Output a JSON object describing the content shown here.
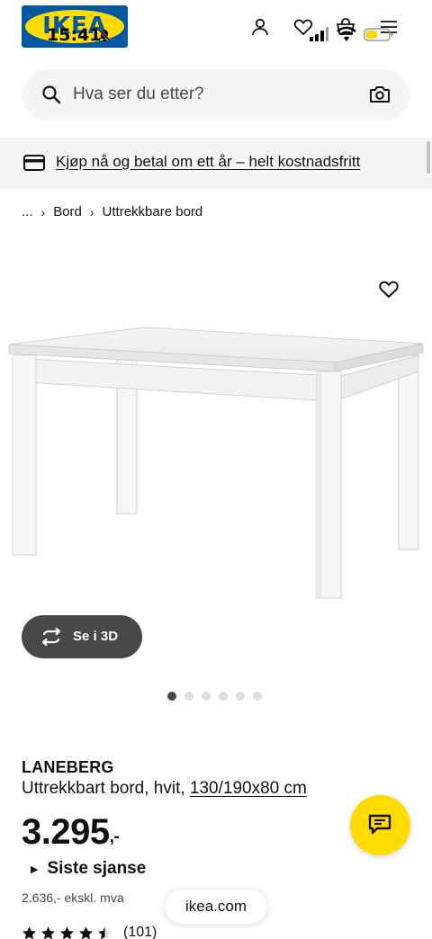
{
  "status_bar": {
    "time": "15:41"
  },
  "header": {
    "logo_text": "IKEA",
    "icons": [
      "user-icon",
      "heart-icon",
      "shopping-bag-icon",
      "menu-icon"
    ]
  },
  "search": {
    "placeholder": "Hva ser du etter?",
    "value": ""
  },
  "promo": {
    "text": "Kjøp nå og betal om ett år – helt kostnadsfritt"
  },
  "breadcrumb": {
    "ellipsis": "...",
    "items": [
      "Bord",
      "Uttrekkbare bord"
    ]
  },
  "gallery": {
    "view_3d_label": "Se i 3D",
    "image_count": 6,
    "active_index": 0
  },
  "product": {
    "name": "LANEBERG",
    "description": "Uttrekkbart bord, hvit,",
    "dimensions": "130/190x80 cm",
    "price": "3.295",
    "price_suffix": ",-",
    "last_chance": "Siste sjanse",
    "price_ex_vat": "2.636,- ekskl. mva",
    "rating_value": 4.5,
    "rating_count": "(101)"
  },
  "browser": {
    "url": "ikea.com"
  },
  "colors": {
    "ikea_blue": "#0058a3",
    "ikea_yellow": "#ffdb00",
    "surface_grey": "#f5f5f5",
    "dark_grey": "#484848"
  }
}
